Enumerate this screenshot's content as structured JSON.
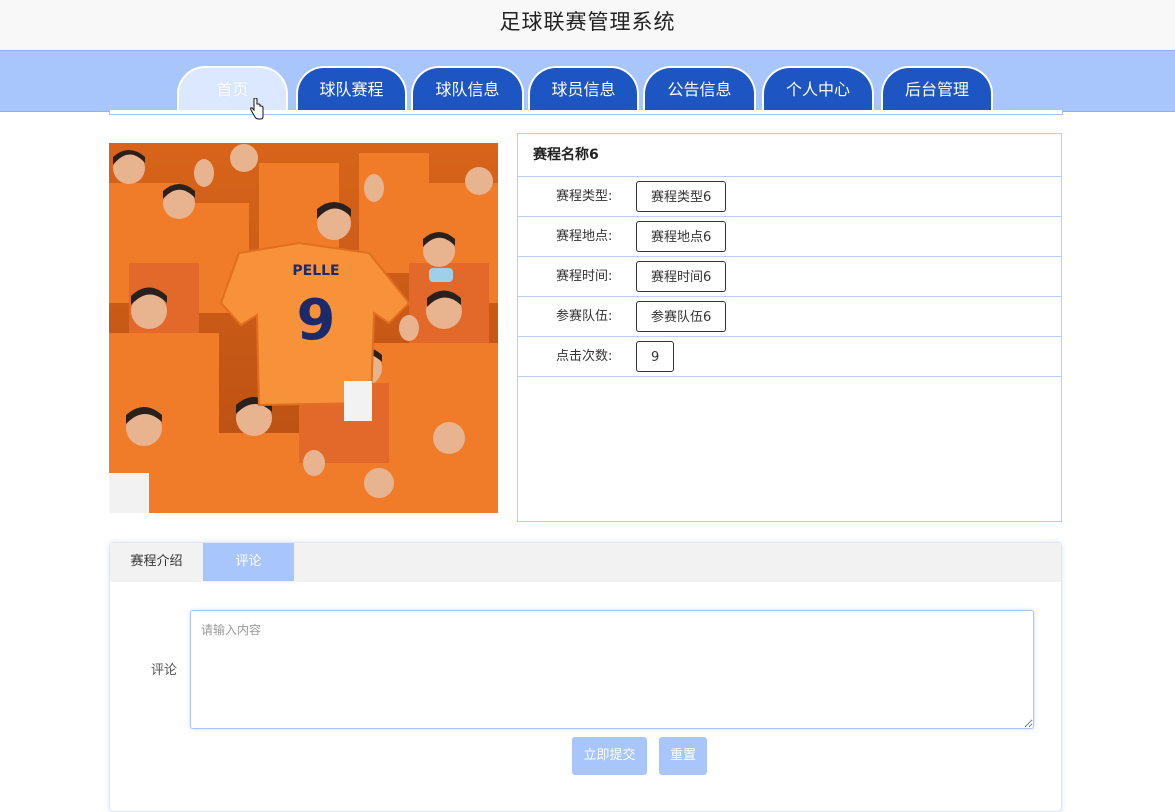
{
  "app": {
    "title": "足球联赛管理系统"
  },
  "nav": {
    "items": [
      {
        "label": "首页",
        "active": true
      },
      {
        "label": "球队赛程"
      },
      {
        "label": "球队信息"
      },
      {
        "label": "球员信息"
      },
      {
        "label": "公告信息"
      },
      {
        "label": "个人中心"
      },
      {
        "label": "后台管理"
      }
    ]
  },
  "photo": {
    "jersey_name": "PELLE",
    "jersey_number": "9"
  },
  "match": {
    "name": "赛程名称6",
    "fields": [
      {
        "label": "赛程类型:",
        "value": "赛程类型6"
      },
      {
        "label": "赛程地点:",
        "value": "赛程地点6"
      },
      {
        "label": "赛程时间:",
        "value": "赛程时间6"
      },
      {
        "label": "参赛队伍:",
        "value": "参赛队伍6"
      },
      {
        "label": "点击次数:",
        "value": "9"
      }
    ]
  },
  "tabs": [
    {
      "label": "赛程介绍"
    },
    {
      "label": "评论",
      "active": true
    }
  ],
  "comment_form": {
    "label": "评论",
    "placeholder": "请输入内容",
    "submit_label": "立即提交",
    "reset_label": "重置"
  },
  "colors": {
    "nav_bg": "#a8c6fb",
    "nav_tab": "#1d55c3",
    "accent": "#a8c6fb",
    "jersey": "#f47a23"
  }
}
